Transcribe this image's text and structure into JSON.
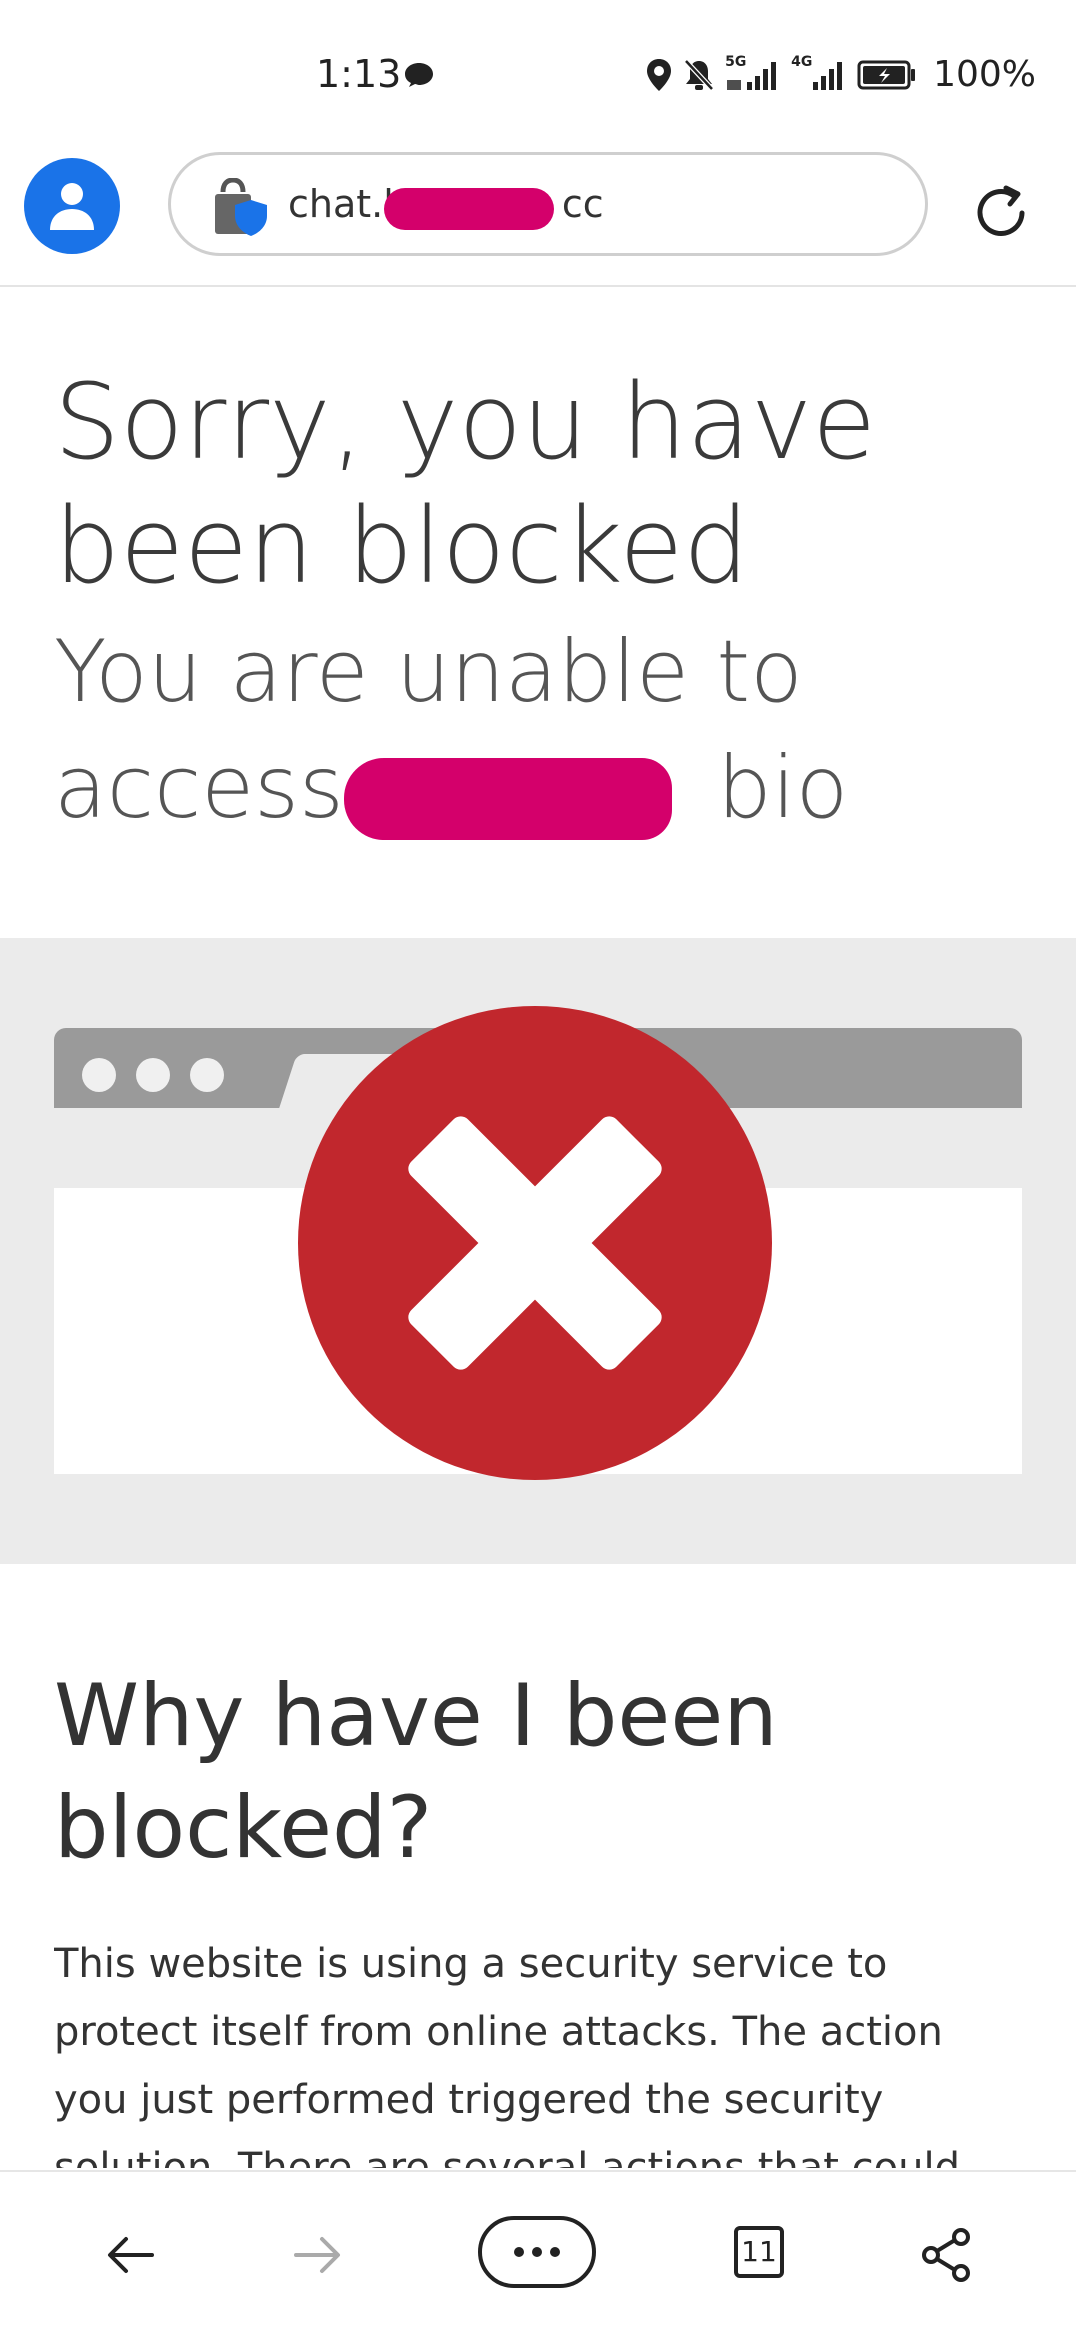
{
  "status_bar": {
    "time": "1:13",
    "signal_5g": "5G",
    "signal_4g": "4G",
    "battery": "100%"
  },
  "browser": {
    "url": "chat.l",
    "url_suffix": "cc"
  },
  "page": {
    "title": "Sorry, you have been blocked",
    "subtitle_start": "You are unable to access",
    "subtitle_end": "bio",
    "why_heading": "Why have I been blocked?",
    "why_text": "This website is using a security service to protect itself from online attacks. The action you just performed triggered the security solution. There are several actions that could"
  },
  "bottom_bar": {
    "tab_count": "11"
  },
  "colors": {
    "accent": "#1a73e8",
    "error_red": "#c1272d",
    "redaction": "#d4006b"
  }
}
